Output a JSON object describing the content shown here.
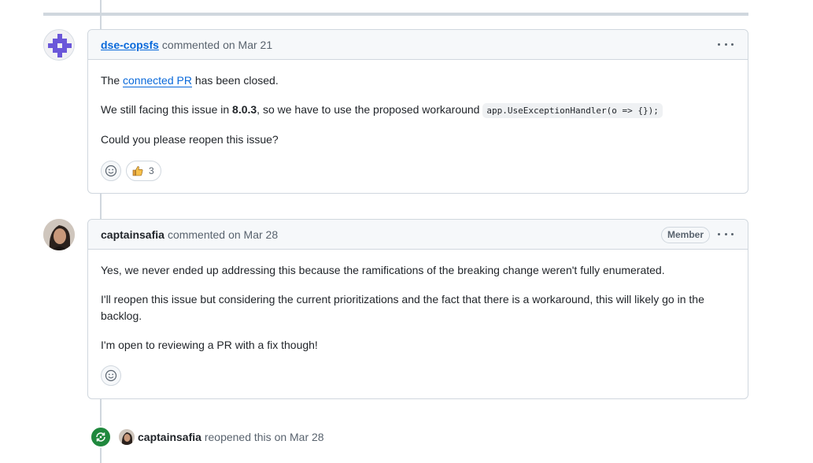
{
  "comments": [
    {
      "author": "dse-copsfs",
      "action": "commented",
      "date": "on Mar 21",
      "body": {
        "p1_before": "The ",
        "p1_link": "connected PR",
        "p1_after": " has been closed.",
        "p2_before": "We still facing this issue in ",
        "p2_version": "8.0.3",
        "p2_after": ", so we have to use the proposed workaround ",
        "p2_code": "app.UseExceptionHandler(o => {});",
        "p3": "Could you please reopen this issue?"
      },
      "reactions": [
        {
          "icon": "thumbs-up-icon",
          "count": "3"
        }
      ]
    },
    {
      "author": "captainsafia",
      "action": "commented",
      "date": "on Mar 28",
      "badge": "Member",
      "body": {
        "p1": "Yes, we never ended up addressing this because the ramifications of the breaking change weren't fully enumerated.",
        "p2": "I'll reopen this issue but considering the current prioritizations and the fact that there is a workaround, this will likely go in the backlog.",
        "p3": "I'm open to reviewing a PR with a fix though!"
      }
    }
  ],
  "event": {
    "actor": "captainsafia",
    "action": "reopened this",
    "date": "on Mar 28",
    "icon": "reopen-icon",
    "color": "#1f883d"
  },
  "colors": {
    "link": "#0969da",
    "border": "#d0d7de",
    "muted": "#59636e",
    "header_bg": "#f6f8fa"
  }
}
